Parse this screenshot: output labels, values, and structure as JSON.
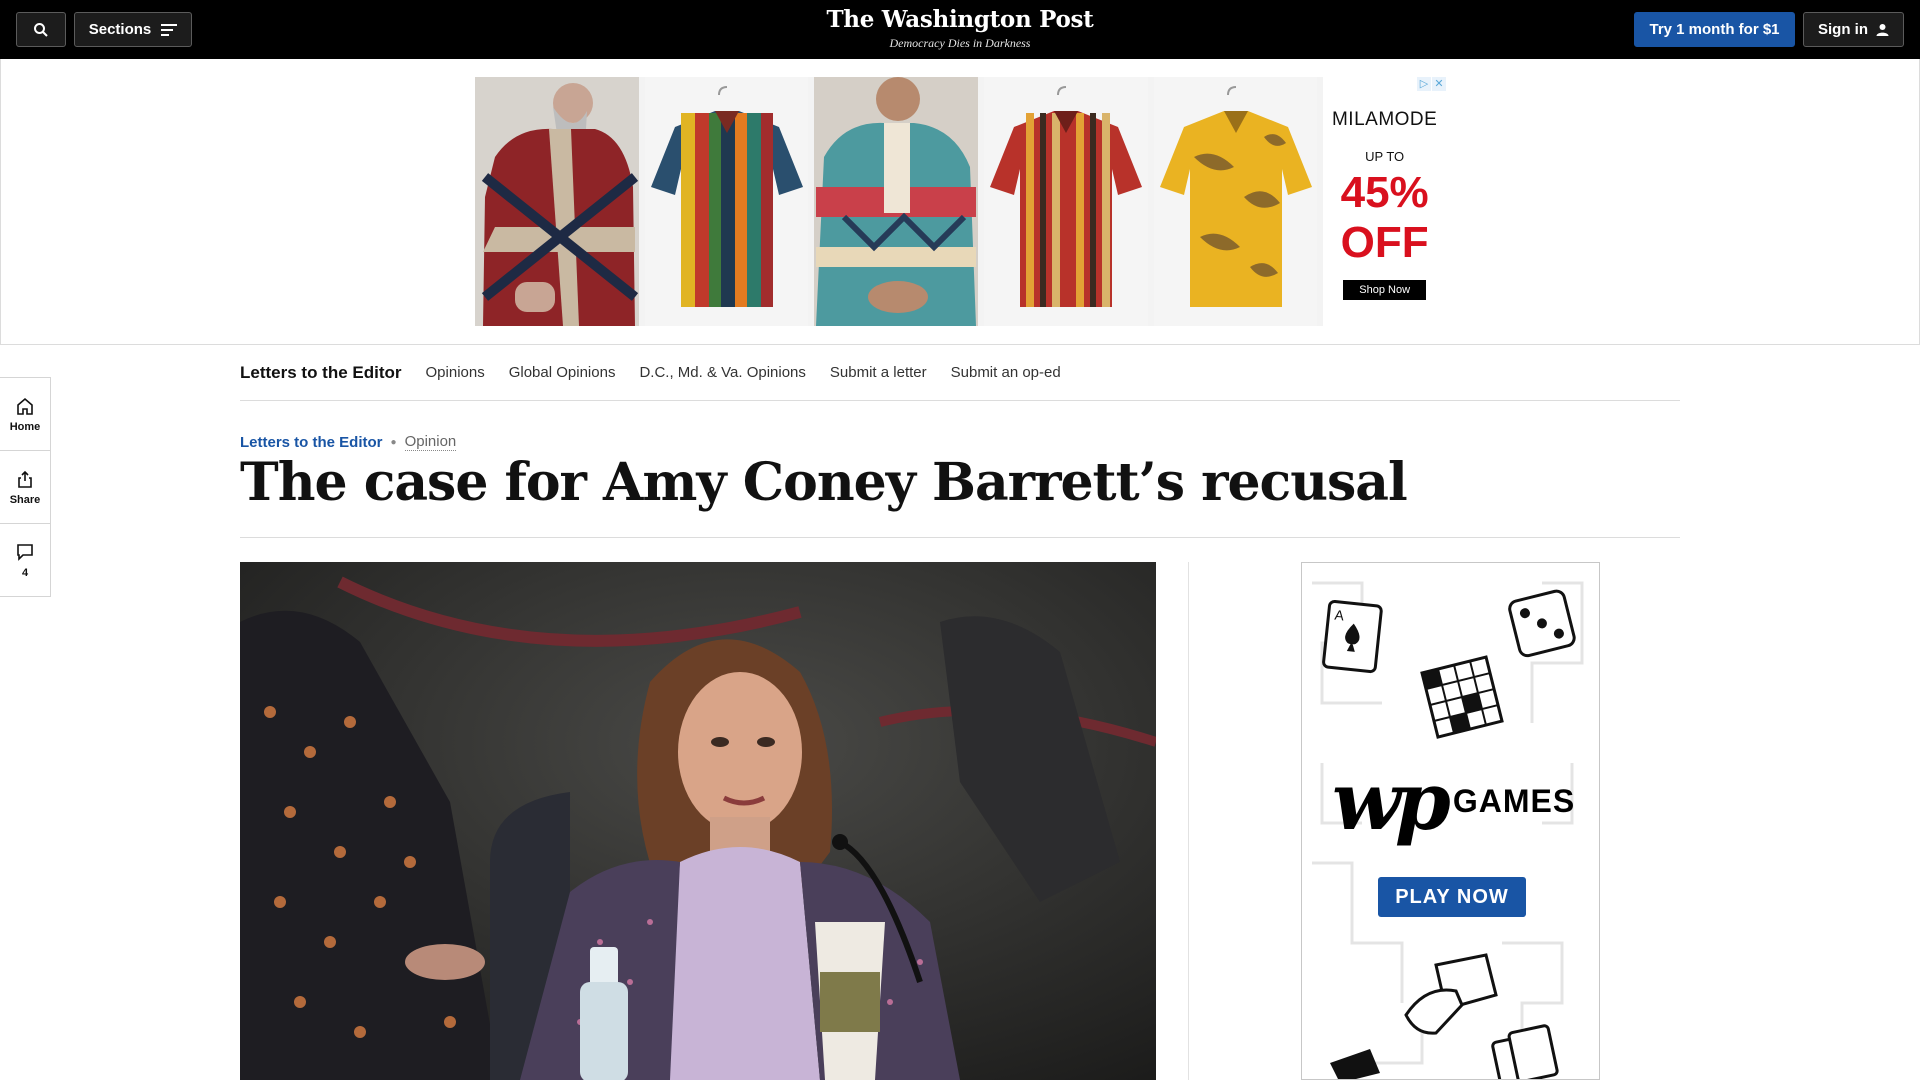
{
  "topbar": {
    "sections_label": "Sections",
    "masthead_title": "The Washington Post",
    "masthead_tagline": "Democracy Dies in Darkness",
    "try_label": "Try 1 month for $1",
    "signin_label": "Sign in"
  },
  "ad_banner": {
    "brand": "MILAMODE",
    "up_to": "UP TO",
    "discount": "45%",
    "off": "OFF",
    "shop_now": "Shop Now"
  },
  "rail": {
    "home": "Home",
    "share": "Share",
    "comments_count": "4"
  },
  "subnav": {
    "main": "Letters to the Editor",
    "links": [
      "Opinions",
      "Global Opinions",
      "D.C., Md. & Va. Opinions",
      "Submit a letter",
      "Submit an op-ed"
    ]
  },
  "article": {
    "kicker_section": "Letters to the Editor",
    "kicker_type": "Opinion",
    "headline": "The case for Amy Coney Barrett’s recusal"
  },
  "side_ad": {
    "logo": "wp",
    "games": "GAMES",
    "play_now": "PLAY NOW"
  },
  "colors": {
    "accent_blue": "#1955a5",
    "ad_red": "#d9101e"
  }
}
